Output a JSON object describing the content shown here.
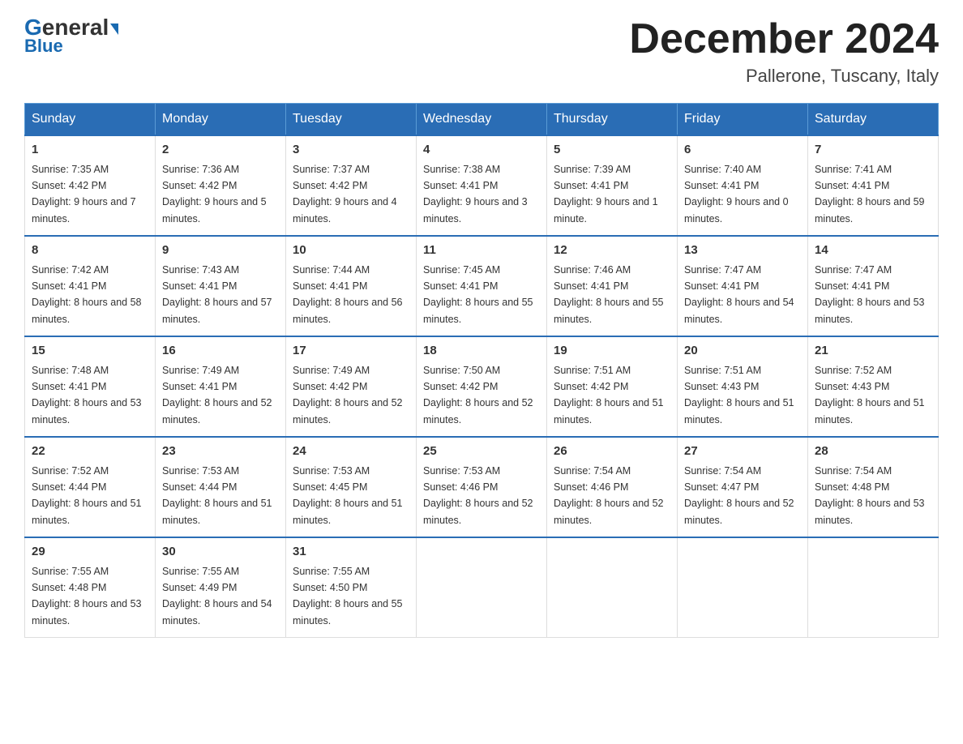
{
  "header": {
    "logo_general": "General",
    "logo_blue": "Blue",
    "month_title": "December 2024",
    "location": "Pallerone, Tuscany, Italy"
  },
  "days_of_week": [
    "Sunday",
    "Monday",
    "Tuesday",
    "Wednesday",
    "Thursday",
    "Friday",
    "Saturday"
  ],
  "weeks": [
    [
      {
        "day": "1",
        "sunrise": "7:35 AM",
        "sunset": "4:42 PM",
        "daylight": "9 hours and 7 minutes."
      },
      {
        "day": "2",
        "sunrise": "7:36 AM",
        "sunset": "4:42 PM",
        "daylight": "9 hours and 5 minutes."
      },
      {
        "day": "3",
        "sunrise": "7:37 AM",
        "sunset": "4:42 PM",
        "daylight": "9 hours and 4 minutes."
      },
      {
        "day": "4",
        "sunrise": "7:38 AM",
        "sunset": "4:41 PM",
        "daylight": "9 hours and 3 minutes."
      },
      {
        "day": "5",
        "sunrise": "7:39 AM",
        "sunset": "4:41 PM",
        "daylight": "9 hours and 1 minute."
      },
      {
        "day": "6",
        "sunrise": "7:40 AM",
        "sunset": "4:41 PM",
        "daylight": "9 hours and 0 minutes."
      },
      {
        "day": "7",
        "sunrise": "7:41 AM",
        "sunset": "4:41 PM",
        "daylight": "8 hours and 59 minutes."
      }
    ],
    [
      {
        "day": "8",
        "sunrise": "7:42 AM",
        "sunset": "4:41 PM",
        "daylight": "8 hours and 58 minutes."
      },
      {
        "day": "9",
        "sunrise": "7:43 AM",
        "sunset": "4:41 PM",
        "daylight": "8 hours and 57 minutes."
      },
      {
        "day": "10",
        "sunrise": "7:44 AM",
        "sunset": "4:41 PM",
        "daylight": "8 hours and 56 minutes."
      },
      {
        "day": "11",
        "sunrise": "7:45 AM",
        "sunset": "4:41 PM",
        "daylight": "8 hours and 55 minutes."
      },
      {
        "day": "12",
        "sunrise": "7:46 AM",
        "sunset": "4:41 PM",
        "daylight": "8 hours and 55 minutes."
      },
      {
        "day": "13",
        "sunrise": "7:47 AM",
        "sunset": "4:41 PM",
        "daylight": "8 hours and 54 minutes."
      },
      {
        "day": "14",
        "sunrise": "7:47 AM",
        "sunset": "4:41 PM",
        "daylight": "8 hours and 53 minutes."
      }
    ],
    [
      {
        "day": "15",
        "sunrise": "7:48 AM",
        "sunset": "4:41 PM",
        "daylight": "8 hours and 53 minutes."
      },
      {
        "day": "16",
        "sunrise": "7:49 AM",
        "sunset": "4:41 PM",
        "daylight": "8 hours and 52 minutes."
      },
      {
        "day": "17",
        "sunrise": "7:49 AM",
        "sunset": "4:42 PM",
        "daylight": "8 hours and 52 minutes."
      },
      {
        "day": "18",
        "sunrise": "7:50 AM",
        "sunset": "4:42 PM",
        "daylight": "8 hours and 52 minutes."
      },
      {
        "day": "19",
        "sunrise": "7:51 AM",
        "sunset": "4:42 PM",
        "daylight": "8 hours and 51 minutes."
      },
      {
        "day": "20",
        "sunrise": "7:51 AM",
        "sunset": "4:43 PM",
        "daylight": "8 hours and 51 minutes."
      },
      {
        "day": "21",
        "sunrise": "7:52 AM",
        "sunset": "4:43 PM",
        "daylight": "8 hours and 51 minutes."
      }
    ],
    [
      {
        "day": "22",
        "sunrise": "7:52 AM",
        "sunset": "4:44 PM",
        "daylight": "8 hours and 51 minutes."
      },
      {
        "day": "23",
        "sunrise": "7:53 AM",
        "sunset": "4:44 PM",
        "daylight": "8 hours and 51 minutes."
      },
      {
        "day": "24",
        "sunrise": "7:53 AM",
        "sunset": "4:45 PM",
        "daylight": "8 hours and 51 minutes."
      },
      {
        "day": "25",
        "sunrise": "7:53 AM",
        "sunset": "4:46 PM",
        "daylight": "8 hours and 52 minutes."
      },
      {
        "day": "26",
        "sunrise": "7:54 AM",
        "sunset": "4:46 PM",
        "daylight": "8 hours and 52 minutes."
      },
      {
        "day": "27",
        "sunrise": "7:54 AM",
        "sunset": "4:47 PM",
        "daylight": "8 hours and 52 minutes."
      },
      {
        "day": "28",
        "sunrise": "7:54 AM",
        "sunset": "4:48 PM",
        "daylight": "8 hours and 53 minutes."
      }
    ],
    [
      {
        "day": "29",
        "sunrise": "7:55 AM",
        "sunset": "4:48 PM",
        "daylight": "8 hours and 53 minutes."
      },
      {
        "day": "30",
        "sunrise": "7:55 AM",
        "sunset": "4:49 PM",
        "daylight": "8 hours and 54 minutes."
      },
      {
        "day": "31",
        "sunrise": "7:55 AM",
        "sunset": "4:50 PM",
        "daylight": "8 hours and 55 minutes."
      },
      null,
      null,
      null,
      null
    ]
  ]
}
